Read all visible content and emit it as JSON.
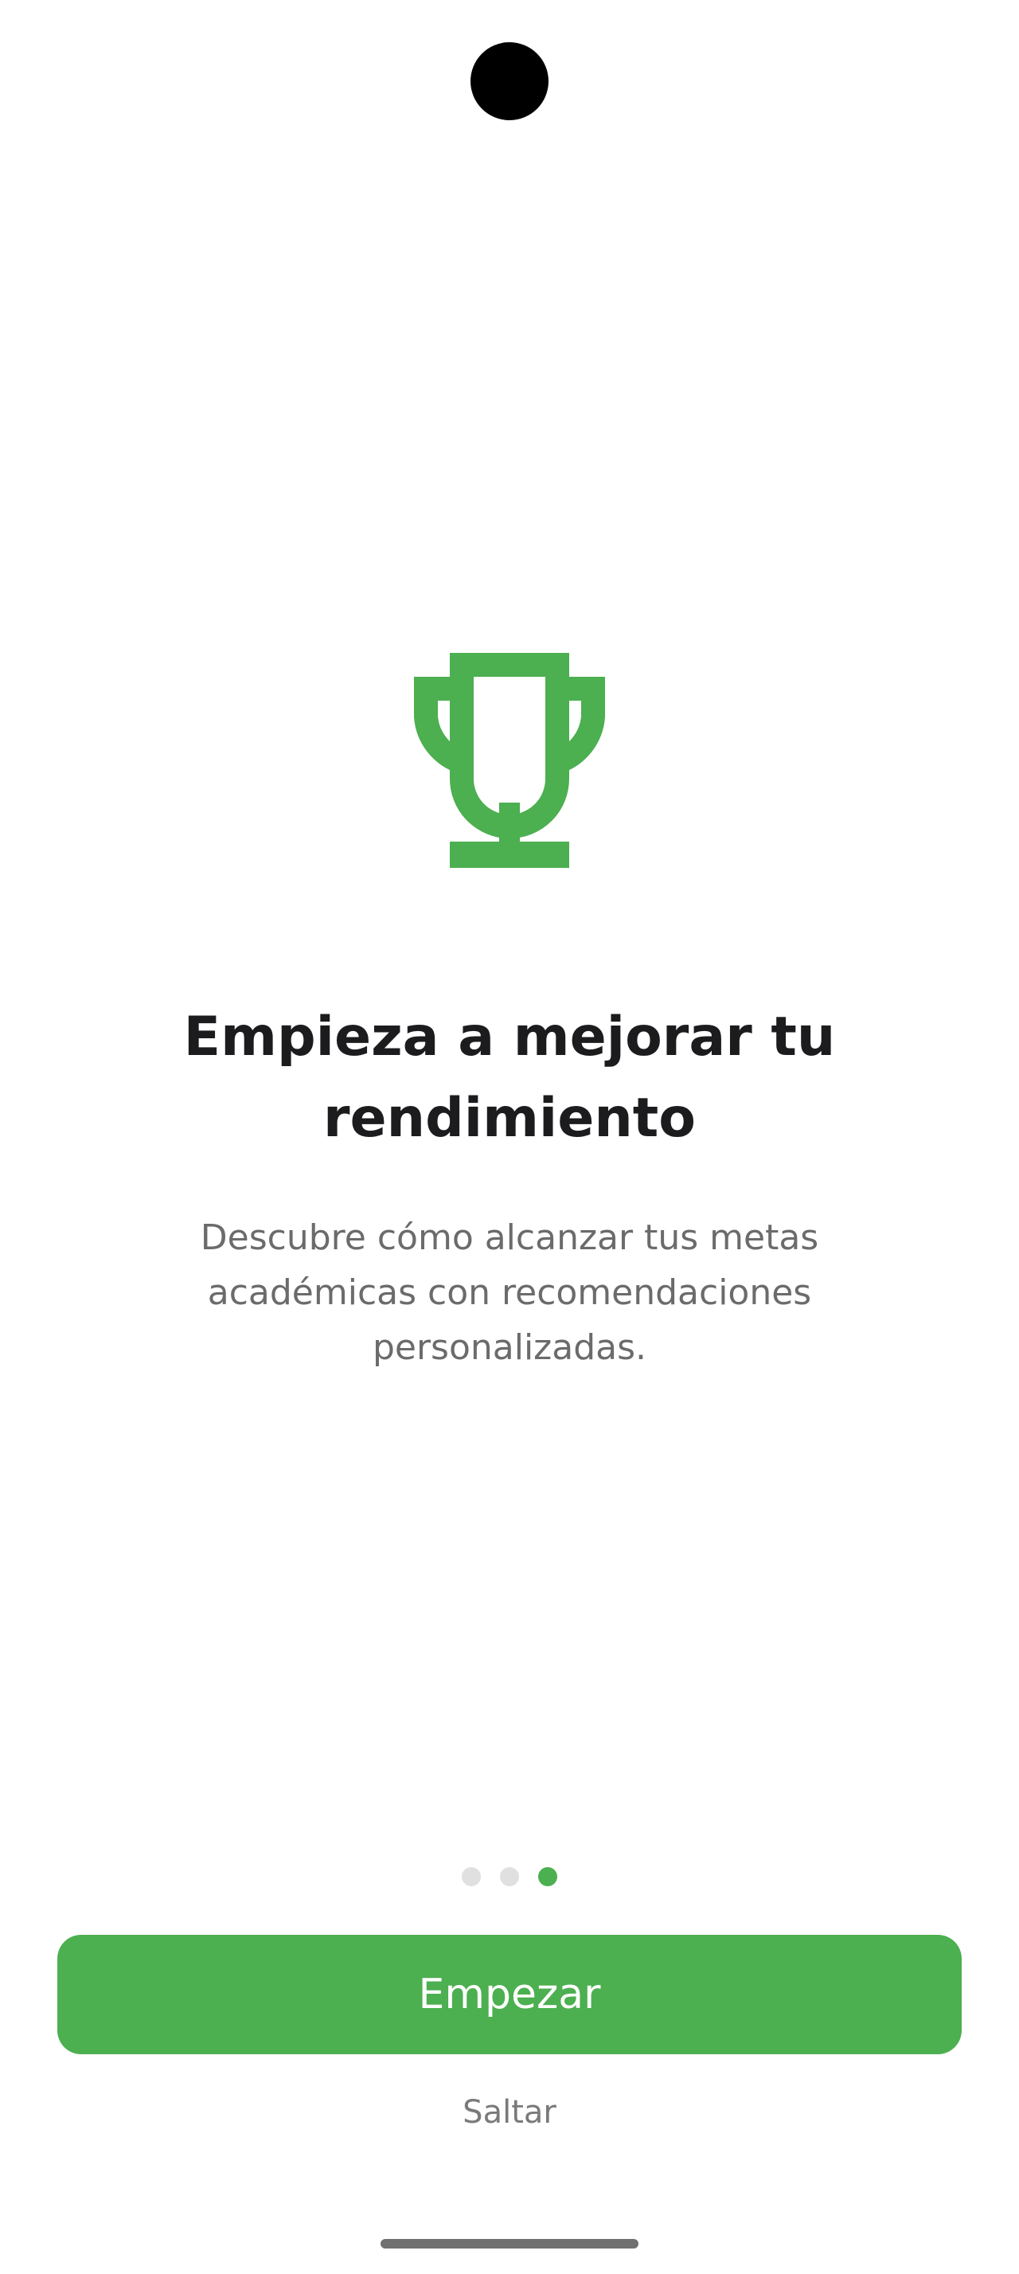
{
  "colors": {
    "accent": "#4caf50",
    "title_text": "#1c1c1e",
    "body_text": "#6b6b6b",
    "dot_inactive": "#e0e0e0"
  },
  "onboarding": {
    "icon": "trophy-icon",
    "title": "Empieza a mejorar tu rendimiento",
    "description": "Descubre cómo alcanzar tus metas académicas con recomendaciones personalizadas.",
    "pages_total": 3,
    "current_page": 3,
    "primary_button_label": "Empezar",
    "skip_label": "Saltar"
  }
}
